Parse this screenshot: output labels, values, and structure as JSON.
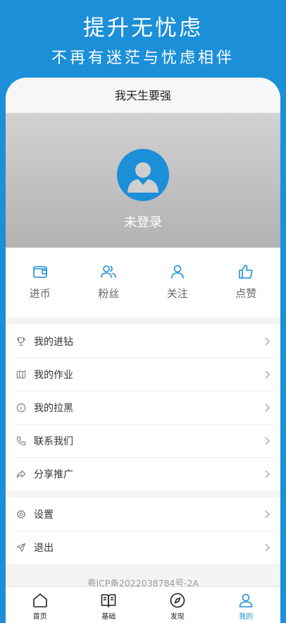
{
  "promo": {
    "title": "提升无忧虑",
    "subtitle": "不再有迷茫与忧虑相伴"
  },
  "navbar": {
    "title": "我天生要强"
  },
  "profile": {
    "login_text": "未登录"
  },
  "stats": [
    {
      "label": "进币",
      "icon": "wallet-icon"
    },
    {
      "label": "粉丝",
      "icon": "users-icon"
    },
    {
      "label": "关注",
      "icon": "user-icon"
    },
    {
      "label": "点赞",
      "icon": "thumbs-up-icon"
    }
  ],
  "menu_main": [
    {
      "label": "我的进钻",
      "icon": "trophy-icon"
    },
    {
      "label": "我的作业",
      "icon": "map-icon"
    },
    {
      "label": "我的拉黑",
      "icon": "info-icon"
    },
    {
      "label": "联系我们",
      "icon": "phone-icon"
    },
    {
      "label": "分享推广",
      "icon": "share-icon"
    }
  ],
  "menu_settings": [
    {
      "label": "设置",
      "icon": "gear-icon"
    },
    {
      "label": "退出",
      "icon": "send-icon"
    }
  ],
  "footer": {
    "icp": "粤ICP备2022038784号-2A"
  },
  "tabbar": [
    {
      "label": "首页",
      "icon": "home-icon"
    },
    {
      "label": "基础",
      "icon": "book-icon"
    },
    {
      "label": "发现",
      "icon": "compass-icon"
    },
    {
      "label": "我的",
      "icon": "user-icon",
      "active": true
    }
  ],
  "colors": {
    "accent": "#1c8fd9",
    "background": "#f4f4f4"
  }
}
